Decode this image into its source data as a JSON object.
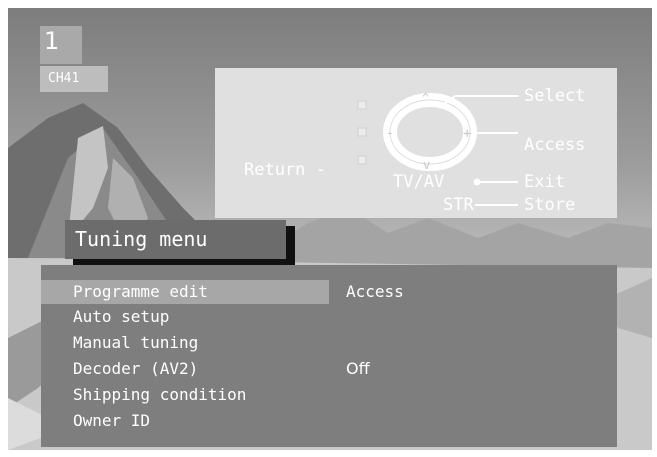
{
  "channel": {
    "number": "1",
    "name": "CH41"
  },
  "help": {
    "select": "Select",
    "access": "Access",
    "return": "Return -",
    "tvav": "TV/AV",
    "exit": "Exit",
    "str": "STR",
    "store": "Store"
  },
  "menu": {
    "title": "Tuning menu",
    "items": [
      {
        "label": "Programme edit",
        "value": "Access",
        "selected": true
      },
      {
        "label": "Auto setup",
        "value": ""
      },
      {
        "label": "Manual tuning",
        "value": ""
      },
      {
        "label": "Decoder (AV2)",
        "value": "Off"
      },
      {
        "label": "Shipping condition",
        "value": ""
      },
      {
        "label": "Owner ID",
        "value": ""
      }
    ]
  },
  "colors": {
    "panel": "#7e7e7e",
    "selected": "#a7a7a7",
    "help_panel": "#e0e0e0",
    "text": "#ffffff"
  }
}
